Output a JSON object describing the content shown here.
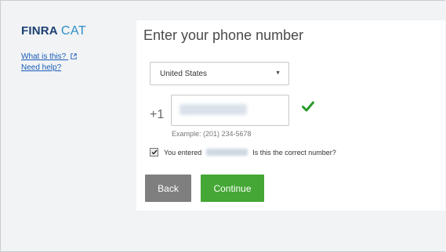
{
  "brand": {
    "finra": "FINRA",
    "cat": "CAT",
    "logo_color": "#1b3f73",
    "cat_color": "#2e8ec9"
  },
  "sidebar": {
    "links": [
      {
        "label": "What is this?",
        "icon": "external-link-icon"
      },
      {
        "label": "Need help?"
      }
    ]
  },
  "form": {
    "title": "Enter your phone number",
    "country": {
      "selected": "United States"
    },
    "dial_code": "+1",
    "phone": {
      "value_masked": true,
      "status_icon": "checkmark-icon",
      "status_color": "#2a9a2a"
    },
    "example": "Example: (201) 234-5678",
    "confirmation": {
      "checked": true,
      "prefix": "You entered",
      "suffix": "Is this the correct number?"
    }
  },
  "buttons": {
    "back": "Back",
    "continue": "Continue",
    "back_color": "#7f7f7f",
    "continue_color": "#45a735"
  }
}
